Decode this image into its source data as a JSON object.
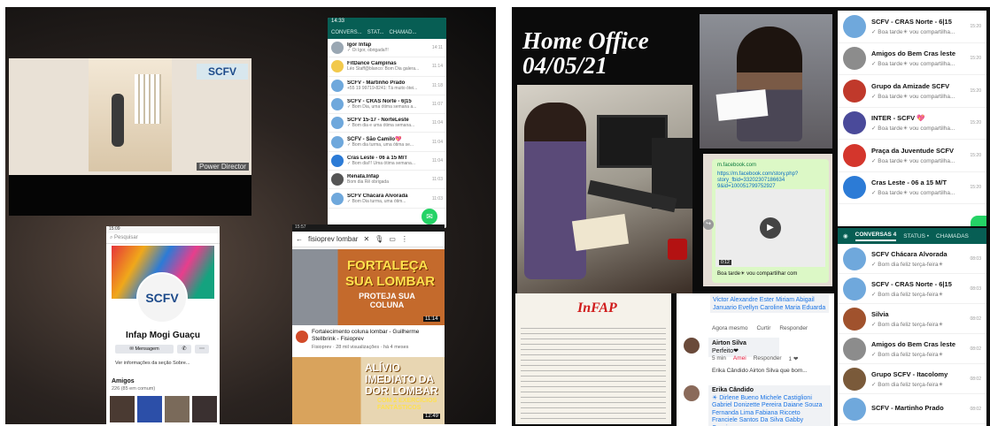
{
  "left": {
    "video": {
      "watermark": "Power Director",
      "logo_text": "SCFV"
    },
    "whatsapp": {
      "status_time": "14:33",
      "tabs": [
        "CONVERS...",
        "STAT...",
        "CHAMAD..."
      ],
      "chats": [
        {
          "name": "Igor Infap",
          "preview": "✓ Oi Igor, obrigada!!!",
          "time": "14:11",
          "color": "#9aa7b3"
        },
        {
          "name": "FitDance Campinas",
          "preview": "Léo Staff@blanco: Bom Dia galera...",
          "time": "11:14",
          "color": "#f2c94c"
        },
        {
          "name": "SCFV - Martinho Prado",
          "preview": "+55 19 99719-8241: Tá muito ótei...",
          "time": "11:18",
          "color": "#6fa8dc"
        },
        {
          "name": "SCFV - CRAS Norte - 6|15",
          "preview": "✓ Bom Dia, uma ótima semana a...",
          "time": "11:07",
          "color": "#6fa8dc"
        },
        {
          "name": "SCFV 15-17 - NorteLeste",
          "preview": "✓ Bom dia e uma ótima semana...",
          "time": "11:04",
          "color": "#6fa8dc"
        },
        {
          "name": "SCFV - São Camilo💖",
          "preview": "✓ Bom dia turma, uma ótima se...",
          "time": "11:04",
          "color": "#6fa8dc"
        },
        {
          "name": "Cras Leste - 06 a 15 M/T",
          "preview": "✓ Bom dia!!! Uma ótima semana...",
          "time": "11:04",
          "color": "#2c7bd6"
        },
        {
          "name": "Renata.Infap",
          "preview": "Bom dia Rê obrigada",
          "time": "11:03",
          "color": "#555"
        },
        {
          "name": "SCFV Chácara Alvorada",
          "preview": "✓ Bom Dia turma, uma ótim...",
          "time": "11:03",
          "color": "#6fa8dc"
        }
      ]
    },
    "facebook": {
      "status_time": "15:09",
      "search_placeholder": "Pesquisar",
      "page_name": "Infap Mogi Guaçu",
      "logo_text": "SCFV",
      "message_button": "✉ Mensagem",
      "info_link": "Ver informações da seção Sobre...",
      "friends_title": "Amigos",
      "friends_count": "226 (85 em comum)"
    },
    "youtube": {
      "status_time": "15:57",
      "query": "fisioprev lombar",
      "thumb1_line1": "FORTALEÇA",
      "thumb1_line2": "SUA LOMBAR",
      "thumb1_line3": "PROTEJA SUA COLUNA",
      "thumb1_duration": "11:14",
      "video_title": "Fortalecimento coluna lombar - Guilherme Stellbrink - Fisioprev",
      "video_meta": "Fisioprev · 28 mil visualizações · há 4 meses",
      "thumb2_line1": "ALÍVIO IMEDIATO DA DOR LOMBAR",
      "thumb2_line2": "COM 2 EXERCÍCIOS FANTÁSTICOS",
      "thumb2_duration": "12:49"
    }
  },
  "right": {
    "title_line1": "Home Office",
    "title_line2": "04/05/21",
    "chat": {
      "site": "m.facebook.com",
      "url": "https://m.facebook.com/story.php?story_fbid=33202307186634 9&id=100051799752927",
      "time": "10:17",
      "video_time": "0:12",
      "message": "Boa tarde☀ vou compartilhar com"
    },
    "whatsapp_top": [
      {
        "name": "SCFV - CRAS Norte - 6|15",
        "preview": "✓ Boa tarde☀ vou compartilha...",
        "time": "15:20",
        "color": "#6fa8dc"
      },
      {
        "name": "Amigos do Bem Cras leste",
        "preview": "✓ Boa tarde☀ vou compartilha...",
        "time": "15:20",
        "color": "#8c8c8c"
      },
      {
        "name": "Grupo da Amizade SCFV",
        "preview": "✓ Boa tarde☀ vou compartilha...",
        "time": "15:20",
        "color": "#c0392b"
      },
      {
        "name": "INTER - SCFV 💖",
        "preview": "✓ Boa tarde☀ vou compartilha...",
        "time": "15:20",
        "color": "#4a4a9a"
      },
      {
        "name": "Praça da Juventude SCFV",
        "preview": "✓ Boa tarde☀ vou compartilha...",
        "time": "15:20",
        "color": "#d4362c"
      },
      {
        "name": "Cras Leste - 06 a 15 M/T",
        "preview": "✓ Boa tarde☀ vou compartilha...",
        "time": "15:20",
        "color": "#2c7bd6"
      }
    ],
    "whatsapp_bottom": {
      "tabs": [
        "CONVERSAS 4",
        "STATUS •",
        "CHAMADAS"
      ],
      "chats": [
        {
          "name": "SCFV Chácara Alvorada",
          "preview": "✓ Bom dia feliz terça-feira☀",
          "time": "08:03",
          "color": "#6fa8dc"
        },
        {
          "name": "SCFV - CRAS Norte - 6|15",
          "preview": "✓ Bom dia feliz terça-feira☀",
          "time": "08:03",
          "color": "#6fa8dc"
        },
        {
          "name": "Silvia",
          "preview": "✓ Bom dia feliz terça-feira☀",
          "time": "08:02",
          "color": "#a0522d"
        },
        {
          "name": "Amigos do Bem Cras leste",
          "preview": "✓ Bom dia feliz terça-feira☀",
          "time": "08:02",
          "color": "#8c8c8c"
        },
        {
          "name": "Grupo SCFV - Itacolomy",
          "preview": "✓ Bom dia feliz terça-feira☀",
          "time": "08:02",
          "color": "#7a5a3a"
        },
        {
          "name": "SCFV - Martinho Prado",
          "preview": "",
          "time": "08:02",
          "color": "#6fa8dc"
        }
      ]
    },
    "document": {
      "logo": "InFAP"
    },
    "comments": {
      "tagged1": "Victor Alexandre Ester Miriam Abigail Januario Evellyn Caroline Maria Eduarda",
      "actions1": [
        "Agora mesmo",
        "Curtir",
        "Responder"
      ],
      "author2": "Airton Silva",
      "text2": "Perfeito❤",
      "actions2": [
        "5 min",
        "Amei",
        "Responder",
        "1 ❤"
      ],
      "reply_preview": "Erika Cândido Airton Silva que bom...",
      "author3": "Erika Cândido",
      "text3": "☀ Dirlene Bueno Michele Castiglioni Gabriel Donizette Pereira Daiane Souza Fernanda Lima Fabiana Ricceto Franciele Santos Da Silva Gabby Casciano"
    }
  }
}
